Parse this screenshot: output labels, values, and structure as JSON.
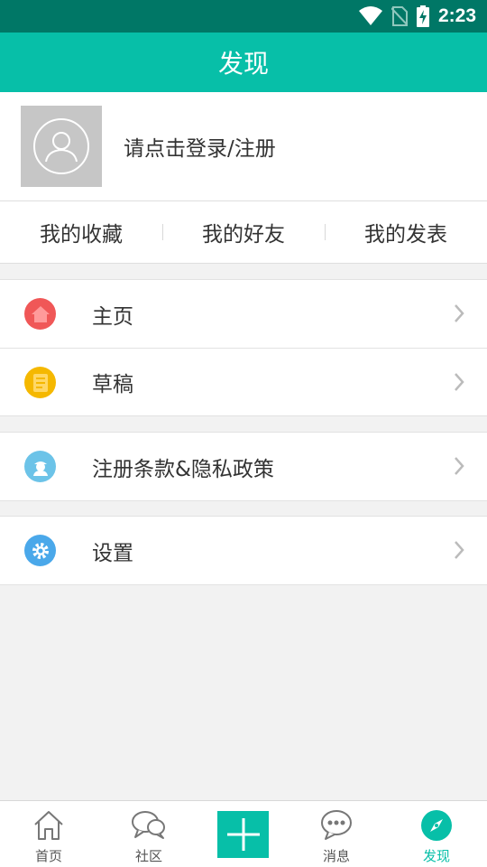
{
  "status_bar": {
    "time": "2:23",
    "icons": [
      "wifi-icon",
      "no-sim-icon",
      "battery-charging-icon"
    ]
  },
  "header": {
    "title": "发现"
  },
  "profile": {
    "login_text": "请点击登录/注册"
  },
  "tabs": [
    {
      "label": "我的收藏"
    },
    {
      "label": "我的好友"
    },
    {
      "label": "我的发表"
    }
  ],
  "menu": {
    "home": {
      "label": "主页",
      "icon": "home-icon",
      "color": "#f05757"
    },
    "drafts": {
      "label": "草稿",
      "icon": "document-icon",
      "color": "#f5b800"
    },
    "terms": {
      "label": "注册条款&隐私政策",
      "icon": "agent-icon",
      "color": "#6cc3e8"
    },
    "settings": {
      "label": "设置",
      "icon": "gear-icon",
      "color": "#4aa8ea"
    }
  },
  "bottom_nav": {
    "items": [
      {
        "label": "首页",
        "icon": "house-outline-icon"
      },
      {
        "label": "社区",
        "icon": "chat-bubbles-icon"
      },
      {
        "label": "",
        "icon": "plus-icon"
      },
      {
        "label": "消息",
        "icon": "message-dots-icon"
      },
      {
        "label": "发现",
        "icon": "compass-icon",
        "active": true
      }
    ]
  },
  "colors": {
    "accent": "#07bfa8",
    "status_bar": "#007766"
  }
}
